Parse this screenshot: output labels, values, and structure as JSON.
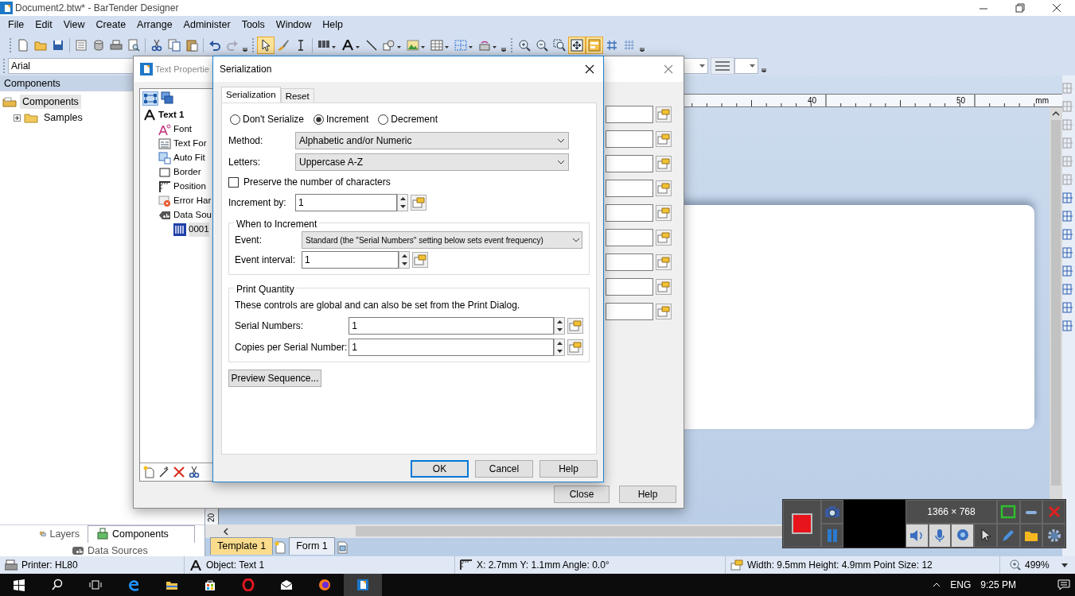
{
  "window": {
    "title": "Document2.btw* - BarTender Designer"
  },
  "menu": [
    "File",
    "Edit",
    "View",
    "Create",
    "Arrange",
    "Administer",
    "Tools",
    "Window",
    "Help"
  ],
  "toolbar_groups": [
    [
      {
        "kind": "new",
        "selected": false
      },
      {
        "kind": "open",
        "selected": false
      },
      {
        "kind": "save",
        "selected": false
      }
    ],
    [
      {
        "kind": "page",
        "selected": false
      },
      {
        "kind": "database",
        "selected": false
      },
      {
        "kind": "print",
        "selected": false
      },
      {
        "kind": "preview",
        "selected": false
      }
    ],
    [
      {
        "kind": "cut",
        "selected": false
      },
      {
        "kind": "copy",
        "selected": false
      },
      {
        "kind": "paste",
        "selected": false
      }
    ],
    [
      {
        "kind": "undo",
        "selected": false
      },
      {
        "kind": "redo",
        "selected": false
      },
      {
        "kind": "more",
        "selected": false
      }
    ],
    [
      {
        "kind": "pointer",
        "selected": true
      },
      {
        "kind": "brush",
        "selected": false
      },
      {
        "kind": "ibeam",
        "selected": false
      }
    ],
    [
      {
        "kind": "barcode",
        "selected": false
      },
      {
        "kind": "text",
        "selected": false
      },
      {
        "kind": "line",
        "selected": false
      },
      {
        "kind": "shape",
        "selected": false
      },
      {
        "kind": "picture",
        "selected": false
      },
      {
        "kind": "table",
        "selected": false
      },
      {
        "kind": "grid",
        "selected": false
      },
      {
        "kind": "rfid",
        "selected": false
      },
      {
        "kind": "more",
        "selected": false
      }
    ],
    [
      {
        "kind": "zoomin",
        "selected": false
      },
      {
        "kind": "zoomout",
        "selected": false
      },
      {
        "kind": "zoomarea",
        "selected": false
      },
      {
        "kind": "fit",
        "selected": true
      },
      {
        "kind": "layout",
        "selected": true
      },
      {
        "kind": "snap",
        "selected": false
      },
      {
        "kind": "dots",
        "selected": false
      },
      {
        "kind": "more",
        "selected": false
      }
    ]
  ],
  "font_toolbar": {
    "font": "Arial"
  },
  "components_panel": {
    "header": "Components",
    "tree": [
      {
        "label": "Components",
        "selected": true,
        "children": [
          {
            "label": "Samples",
            "selected": false,
            "expanded": false
          }
        ]
      }
    ]
  },
  "panel_tabs": [
    {
      "label": "Layers",
      "selected": false
    },
    {
      "label": "Components",
      "selected": true
    },
    {
      "label": "Data Sources",
      "selected": false
    }
  ],
  "ruler": {
    "labels": [
      "40",
      "50"
    ],
    "unit": "mm"
  },
  "vertical_ruler": {
    "label": "20"
  },
  "template_tabs": [
    {
      "label": "Template 1",
      "selected": true
    },
    {
      "label": "Form 1",
      "selected": false
    }
  ],
  "text_properties": {
    "title": "Text Propertie",
    "tree": [
      {
        "label": "Text 1",
        "kind": "text",
        "children": [
          {
            "label": "Font",
            "kind": "font"
          },
          {
            "label": "Text For",
            "kind": "format"
          },
          {
            "label": "Auto Fit",
            "kind": "autofit"
          },
          {
            "label": "Border",
            "kind": "border"
          },
          {
            "label": "Position",
            "kind": "position"
          },
          {
            "label": "Error Har",
            "kind": "error"
          },
          {
            "label": "Data Sou",
            "kind": "datasource",
            "children": [
              {
                "label": "0001",
                "kind": "serial",
                "selected": true
              }
            ]
          }
        ]
      }
    ],
    "buttons": [
      "Close",
      "Help"
    ]
  },
  "serialization": {
    "title": "Serialization",
    "tabs": [
      {
        "label": "Serialization",
        "selected": true
      },
      {
        "label": "Reset",
        "selected": false
      }
    ],
    "modes": [
      {
        "label": "Don't Serialize",
        "selected": false
      },
      {
        "label": "Increment",
        "selected": true
      },
      {
        "label": "Decrement",
        "selected": false
      }
    ],
    "method": {
      "label": "Method:",
      "value": "Alphabetic and/or Numeric"
    },
    "letters": {
      "label": "Letters:",
      "value": "Uppercase A-Z"
    },
    "preserve": {
      "label": "Preserve the number of characters",
      "checked": false
    },
    "increment_by": {
      "label": "Increment by:",
      "value": "1"
    },
    "when_to_increment": {
      "title": "When to Increment",
      "event": {
        "label": "Event:",
        "value": "Standard (the \"Serial Numbers\" setting below sets event frequency)"
      },
      "event_interval": {
        "label": "Event interval:",
        "value": "1"
      }
    },
    "print_quantity": {
      "title": "Print Quantity",
      "note": "These controls are global and can also be set from the Print Dialog.",
      "serial_numbers": {
        "label": "Serial Numbers:",
        "value": "1"
      },
      "copies": {
        "label": "Copies per Serial Number:",
        "value": "1"
      }
    },
    "preview_button": "Preview Sequence...",
    "buttons": [
      {
        "label": "OK",
        "default": true
      },
      {
        "label": "Cancel",
        "default": false
      },
      {
        "label": "Help",
        "default": false
      }
    ]
  },
  "status_bar": {
    "printer": "Printer: HL80",
    "object": "Object: Text 1",
    "position": "X: 2.7mm  Y: 1.1mm  Angle: 0.0°",
    "size": "Width: 9.5mm  Height: 4.9mm  Point Size: 12",
    "zoom": "499%"
  },
  "recorder": {
    "resolution": "1366 × 768"
  },
  "taskbar": {
    "language": "ENG",
    "time": "9:25 PM"
  }
}
